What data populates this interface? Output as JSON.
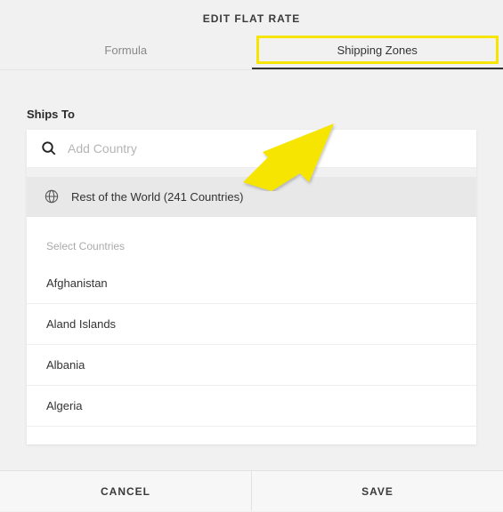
{
  "header": {
    "title": "EDIT FLAT RATE",
    "tabs": {
      "formula": "Formula",
      "shippingZones": "Shipping Zones"
    }
  },
  "content": {
    "shipsToLabel": "Ships To",
    "searchPlaceholder": "Add Country",
    "restOfWorld": "Rest of the World (241 Countries)",
    "selectCountriesLabel": "Select Countries",
    "countries": {
      "0": "Afghanistan",
      "1": "Aland Islands",
      "2": "Albania",
      "3": "Algeria"
    }
  },
  "footer": {
    "cancel": "CANCEL",
    "save": "SAVE"
  }
}
